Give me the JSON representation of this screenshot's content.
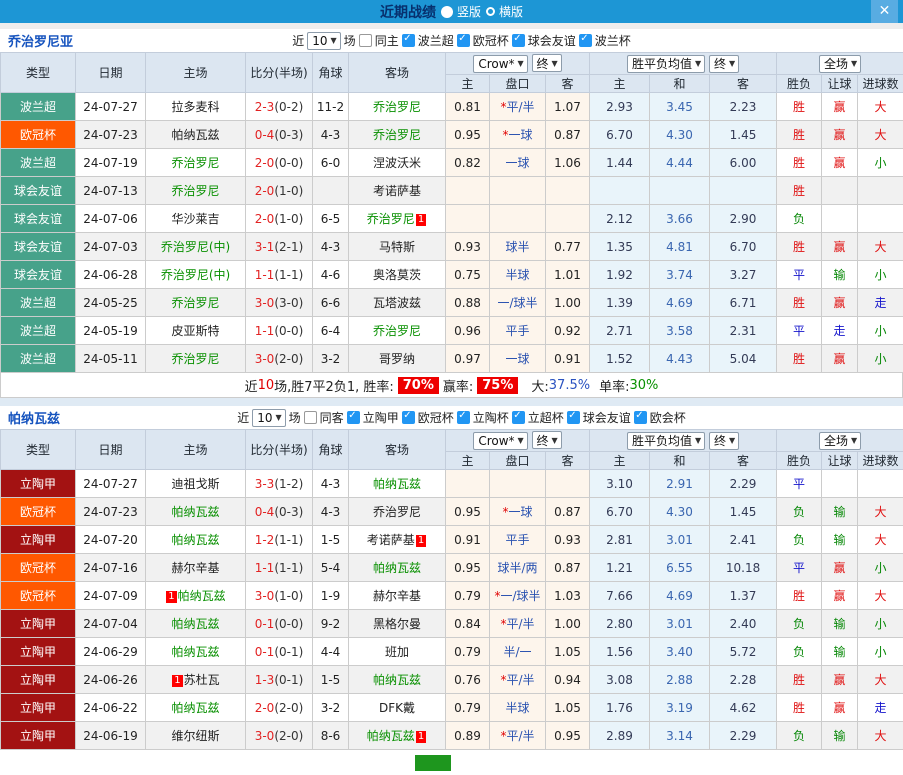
{
  "colors": {
    "topbar": "#1d96d5",
    "close_button": "#58ace2",
    "title_text": "#07306e",
    "team_name": "#1553be",
    "checkbox_checked": "#2196f3",
    "header_bg": "#dce6f1",
    "odds_col_bg": "#fdf5ec",
    "avg_col_bg": "#e9f4fa",
    "score_red": "#e22222",
    "green_team": "#089000",
    "handicap_blue": "#2a52b0",
    "badge_red_bg": "#ee0000",
    "badge_green_bg": "#1e961e",
    "league": {
      "teal": "#47a28a",
      "orange": "#ff5800",
      "darkred": "#a31212"
    },
    "result": {
      "red": "#e01111",
      "blue": "#1414cc",
      "green": "#078807"
    }
  },
  "titlebar": {
    "title": "近期战绩",
    "vertical_label": "竖版",
    "horizontal_label": "横版",
    "close_label": "✕"
  },
  "sections": [
    {
      "team": "乔治罗尼亚",
      "filter": {
        "near": "近",
        "count": "10",
        "field": "场",
        "same": "同主",
        "same_checked": false,
        "leagues": [
          {
            "label": "波兰超",
            "checked": true
          },
          {
            "label": "欧冠杯",
            "checked": true
          },
          {
            "label": "球会友谊",
            "checked": true
          },
          {
            "label": "波兰杯",
            "checked": true
          }
        ]
      },
      "dropdowns": {
        "company": "Crow*",
        "final1": "终",
        "avg": "胜平负均值",
        "final2": "终",
        "scope": "全场"
      },
      "columns": {
        "type": "类型",
        "date": "日期",
        "home": "主场",
        "score": "比分(半场)",
        "corner": "角球",
        "away": "客场",
        "odds_home": "主",
        "handicap": "盘口",
        "odds_away": "客",
        "avg_home": "主",
        "avg_draw": "和",
        "avg_away": "客",
        "result": "胜负",
        "handicap_result": "让球",
        "goals": "进球数"
      },
      "rows": [
        {
          "league": "波兰超",
          "lc": "teal",
          "date": "24-07-27",
          "home": "拉多麦科",
          "hg": false,
          "score": "2-3",
          "half": "(0-2)",
          "corner": "11-2",
          "away": "乔治罗尼",
          "ag": true,
          "oh": "0.81",
          "star": true,
          "hcp": "平/半",
          "oa": "1.07",
          "ah": "2.93",
          "ad": "3.45",
          "aa": "2.23",
          "res": "胜",
          "resC": "red",
          "hr": "赢",
          "hrC": "red",
          "gl": "大",
          "glC": "red"
        },
        {
          "league": "欧冠杯",
          "lc": "orange",
          "date": "24-07-23",
          "home": "帕纳瓦兹",
          "hg": false,
          "score": "0-4",
          "half": "(0-3)",
          "corner": "4-3",
          "away": "乔治罗尼",
          "ag": true,
          "oh": "0.95",
          "star": true,
          "hcp": "一球",
          "oa": "0.87",
          "ah": "6.70",
          "ad": "4.30",
          "aa": "1.45",
          "res": "胜",
          "resC": "red",
          "hr": "赢",
          "hrC": "red",
          "gl": "大",
          "glC": "red"
        },
        {
          "league": "波兰超",
          "lc": "teal",
          "date": "24-07-19",
          "home": "乔治罗尼",
          "hg": true,
          "score": "2-0",
          "half": "(0-0)",
          "corner": "6-0",
          "away": "涅波沃米",
          "ag": false,
          "oh": "0.82",
          "star": false,
          "hcp": "一球",
          "oa": "1.06",
          "ah": "1.44",
          "ad": "4.44",
          "aa": "6.00",
          "res": "胜",
          "resC": "red",
          "hr": "赢",
          "hrC": "red",
          "gl": "小",
          "glC": "green"
        },
        {
          "league": "球会友谊",
          "lc": "teal",
          "date": "24-07-13",
          "home": "乔治罗尼",
          "hg": true,
          "score": "2-0",
          "half": "(1-0)",
          "corner": "",
          "away": "考诺萨基",
          "ag": false,
          "oh": "",
          "star": false,
          "hcp": "",
          "oa": "",
          "ah": "",
          "ad": "",
          "aa": "",
          "res": "胜",
          "resC": "red",
          "hr": "",
          "gl": ""
        },
        {
          "league": "球会友谊",
          "lc": "teal",
          "date": "24-07-06",
          "home": "华沙莱吉",
          "hg": false,
          "score": "2-0",
          "half": "(1-0)",
          "corner": "6-5",
          "away": "乔治罗尼",
          "ag": true,
          "abadge": "1",
          "oh": "",
          "star": false,
          "hcp": "",
          "oa": "",
          "ah": "2.12",
          "ad": "3.66",
          "aa": "2.90",
          "res": "负",
          "resC": "green",
          "hr": "",
          "gl": ""
        },
        {
          "league": "球会友谊",
          "lc": "teal",
          "date": "24-07-03",
          "home": "乔治罗尼(中)",
          "hg": true,
          "score": "3-1",
          "half": "(2-1)",
          "corner": "4-3",
          "away": "马特斯",
          "ag": false,
          "oh": "0.93",
          "star": false,
          "hcp": "球半",
          "oa": "0.77",
          "ah": "1.35",
          "ad": "4.81",
          "aa": "6.70",
          "res": "胜",
          "resC": "red",
          "hr": "赢",
          "hrC": "red",
          "gl": "大",
          "glC": "red"
        },
        {
          "league": "球会友谊",
          "lc": "teal",
          "date": "24-06-28",
          "home": "乔治罗尼(中)",
          "hg": true,
          "score": "1-1",
          "half": "(1-1)",
          "corner": "4-6",
          "away": "奥洛莫茨",
          "ag": false,
          "oh": "0.75",
          "star": false,
          "hcp": "半球",
          "oa": "1.01",
          "ah": "1.92",
          "ad": "3.74",
          "aa": "3.27",
          "res": "平",
          "resC": "blue",
          "hr": "输",
          "hrC": "green",
          "gl": "小",
          "glC": "green"
        },
        {
          "league": "波兰超",
          "lc": "teal",
          "date": "24-05-25",
          "home": "乔治罗尼",
          "hg": true,
          "score": "3-0",
          "half": "(3-0)",
          "corner": "6-6",
          "away": "瓦塔波兹",
          "ag": false,
          "oh": "0.88",
          "star": false,
          "hcp": "一/球半",
          "oa": "1.00",
          "ah": "1.39",
          "ad": "4.69",
          "aa": "6.71",
          "res": "胜",
          "resC": "red",
          "hr": "赢",
          "hrC": "red",
          "gl": "走",
          "glC": "blue"
        },
        {
          "league": "波兰超",
          "lc": "teal",
          "date": "24-05-19",
          "home": "皮亚斯特",
          "hg": false,
          "score": "1-1",
          "half": "(0-0)",
          "corner": "6-4",
          "away": "乔治罗尼",
          "ag": true,
          "oh": "0.96",
          "star": false,
          "hcp": "平手",
          "oa": "0.92",
          "ah": "2.71",
          "ad": "3.58",
          "aa": "2.31",
          "res": "平",
          "resC": "blue",
          "hr": "走",
          "hrC": "blue",
          "gl": "小",
          "glC": "green"
        },
        {
          "league": "波兰超",
          "lc": "teal",
          "date": "24-05-11",
          "home": "乔治罗尼",
          "hg": true,
          "score": "3-0",
          "half": "(2-0)",
          "corner": "3-2",
          "away": "哥罗纳",
          "ag": false,
          "oh": "0.97",
          "star": false,
          "hcp": "一球",
          "oa": "0.91",
          "ah": "1.52",
          "ad": "4.43",
          "aa": "5.04",
          "res": "胜",
          "resC": "red",
          "hr": "赢",
          "hrC": "red",
          "gl": "小",
          "glC": "green"
        }
      ],
      "summary": {
        "pre": "近",
        "count": "10",
        "post": "场,胜7平2负1, 胜率:",
        "win_pct": "70%",
        "label2": "赢率:",
        "win2_pct": "75%",
        "label3": "大:",
        "big_pct": "37.5%",
        "label4": "单率:",
        "single_pct": "30%"
      }
    },
    {
      "team": "帕纳瓦兹",
      "filter": {
        "near": "近",
        "count": "10",
        "field": "场",
        "same": "同客",
        "same_checked": false,
        "leagues": [
          {
            "label": "立陶甲",
            "checked": true
          },
          {
            "label": "欧冠杯",
            "checked": true
          },
          {
            "label": "立陶杯",
            "checked": true
          },
          {
            "label": "立超杯",
            "checked": true
          },
          {
            "label": "球会友谊",
            "checked": true
          },
          {
            "label": "欧会杯",
            "checked": true
          }
        ]
      },
      "dropdowns": {
        "company": "Crow*",
        "final1": "终",
        "avg": "胜平负均值",
        "final2": "终",
        "scope": "全场"
      },
      "columns": {
        "type": "类型",
        "date": "日期",
        "home": "主场",
        "score": "比分(半场)",
        "corner": "角球",
        "away": "客场",
        "odds_home": "主",
        "handicap": "盘口",
        "odds_away": "客",
        "avg_home": "主",
        "avg_draw": "和",
        "avg_away": "客",
        "result": "胜负",
        "handicap_result": "让球",
        "goals": "进球数"
      },
      "rows": [
        {
          "league": "立陶甲",
          "lc": "darkred",
          "date": "24-07-27",
          "home": "迪祖戈斯",
          "hg": false,
          "score": "3-3",
          "half": "(1-2)",
          "corner": "4-3",
          "away": "帕纳瓦兹",
          "ag": true,
          "oh": "",
          "star": false,
          "hcp": "",
          "oa": "",
          "ah": "3.10",
          "ad": "2.91",
          "aa": "2.29",
          "res": "平",
          "resC": "blue",
          "hr": "",
          "gl": ""
        },
        {
          "league": "欧冠杯",
          "lc": "orange",
          "date": "24-07-23",
          "home": "帕纳瓦兹",
          "hg": true,
          "score": "0-4",
          "half": "(0-3)",
          "corner": "4-3",
          "away": "乔治罗尼",
          "ag": false,
          "oh": "0.95",
          "star": true,
          "hcp": "一球",
          "oa": "0.87",
          "ah": "6.70",
          "ad": "4.30",
          "aa": "1.45",
          "res": "负",
          "resC": "green",
          "hr": "输",
          "hrC": "green",
          "gl": "大",
          "glC": "red"
        },
        {
          "league": "立陶甲",
          "lc": "darkred",
          "date": "24-07-20",
          "home": "帕纳瓦兹",
          "hg": true,
          "score": "1-2",
          "half": "(1-1)",
          "corner": "1-5",
          "away": "考诺萨基",
          "ag": false,
          "abadge": "1",
          "oh": "0.91",
          "star": false,
          "hcp": "平手",
          "oa": "0.93",
          "ah": "2.81",
          "ad": "3.01",
          "aa": "2.41",
          "res": "负",
          "resC": "green",
          "hr": "输",
          "hrC": "green",
          "gl": "大",
          "glC": "red"
        },
        {
          "league": "欧冠杯",
          "lc": "orange",
          "date": "24-07-16",
          "home": "赫尔辛基",
          "hg": false,
          "score": "1-1",
          "half": "(1-1)",
          "corner": "5-4",
          "away": "帕纳瓦兹",
          "ag": true,
          "oh": "0.95",
          "star": false,
          "hcp": "球半/两",
          "oa": "0.87",
          "ah": "1.21",
          "ad": "6.55",
          "aa": "10.18",
          "res": "平",
          "resC": "blue",
          "hr": "赢",
          "hrC": "red",
          "gl": "小",
          "glC": "green"
        },
        {
          "league": "欧冠杯",
          "lc": "orange",
          "date": "24-07-09",
          "home": "帕纳瓦兹",
          "hg": true,
          "hbadge": "1",
          "score": "3-0",
          "half": "(1-0)",
          "corner": "1-9",
          "away": "赫尔辛基",
          "ag": false,
          "oh": "0.79",
          "star": true,
          "hcp": "一/球半",
          "oa": "1.03",
          "ah": "7.66",
          "ad": "4.69",
          "aa": "1.37",
          "res": "胜",
          "resC": "red",
          "hr": "赢",
          "hrC": "red",
          "gl": "大",
          "glC": "red"
        },
        {
          "league": "立陶甲",
          "lc": "darkred",
          "date": "24-07-04",
          "home": "帕纳瓦兹",
          "hg": true,
          "score": "0-1",
          "half": "(0-0)",
          "corner": "9-2",
          "away": "黑格尔曼",
          "ag": false,
          "oh": "0.84",
          "star": true,
          "hcp": "平/半",
          "oa": "1.00",
          "ah": "2.80",
          "ad": "3.01",
          "aa": "2.40",
          "res": "负",
          "resC": "green",
          "hr": "输",
          "hrC": "green",
          "gl": "小",
          "glC": "green"
        },
        {
          "league": "立陶甲",
          "lc": "darkred",
          "date": "24-06-29",
          "home": "帕纳瓦兹",
          "hg": true,
          "score": "0-1",
          "half": "(0-1)",
          "corner": "4-4",
          "away": "班加",
          "ag": false,
          "oh": "0.79",
          "star": false,
          "hcp": "半/一",
          "oa": "1.05",
          "ah": "1.56",
          "ad": "3.40",
          "aa": "5.72",
          "res": "负",
          "resC": "green",
          "hr": "输",
          "hrC": "green",
          "gl": "小",
          "glC": "green"
        },
        {
          "league": "立陶甲",
          "lc": "darkred",
          "date": "24-06-26",
          "home": "苏杜瓦",
          "hg": false,
          "hbadge": "1",
          "score": "1-3",
          "half": "(0-1)",
          "corner": "1-5",
          "away": "帕纳瓦兹",
          "ag": true,
          "oh": "0.76",
          "star": true,
          "hcp": "平/半",
          "oa": "0.94",
          "ah": "3.08",
          "ad": "2.88",
          "aa": "2.28",
          "res": "胜",
          "resC": "red",
          "hr": "赢",
          "hrC": "red",
          "gl": "大",
          "glC": "red"
        },
        {
          "league": "立陶甲",
          "lc": "darkred",
          "date": "24-06-22",
          "home": "帕纳瓦兹",
          "hg": true,
          "score": "2-0",
          "half": "(2-0)",
          "corner": "3-2",
          "away": "DFK戴",
          "ag": false,
          "oh": "0.79",
          "star": false,
          "hcp": "半球",
          "oa": "1.05",
          "ah": "1.76",
          "ad": "3.19",
          "aa": "4.62",
          "res": "胜",
          "resC": "red",
          "hr": "赢",
          "hrC": "red",
          "gl": "走",
          "glC": "blue"
        },
        {
          "league": "立陶甲",
          "lc": "darkred",
          "date": "24-06-19",
          "home": "维尔纽斯",
          "hg": false,
          "score": "3-0",
          "half": "(2-0)",
          "corner": "8-6",
          "away": "帕纳瓦兹",
          "ag": true,
          "abadge": "1",
          "oh": "0.89",
          "star": true,
          "hcp": "平/半",
          "oa": "0.95",
          "ah": "2.89",
          "ad": "3.14",
          "aa": "2.29",
          "res": "负",
          "resC": "green",
          "hr": "输",
          "hrC": "green",
          "gl": "大",
          "glC": "red"
        }
      ],
      "summary": null
    }
  ]
}
